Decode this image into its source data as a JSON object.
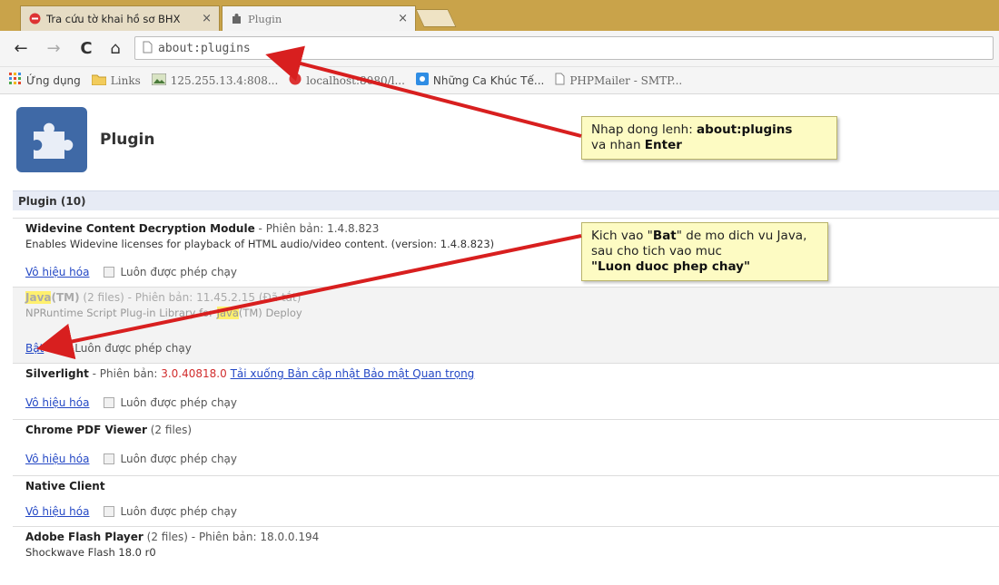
{
  "tabs": [
    {
      "title": "Tra cứu tờ khai hồ sơ BHX",
      "close": "×",
      "active": false
    },
    {
      "title": "Plugin",
      "close": "×",
      "active": true
    }
  ],
  "toolbar": {
    "back": "←",
    "forward": "→",
    "reload": "C",
    "home": "⌂",
    "url": "about:plugins"
  },
  "bookmarks": [
    {
      "label": "Ứng dụng",
      "icon": "apps-grid-icon"
    },
    {
      "label": "Links",
      "icon": "folder-icon"
    },
    {
      "label": "125.255.13.4:808...",
      "icon": "image-icon"
    },
    {
      "label": "localhost:8080/l...",
      "icon": "red-circle-icon"
    },
    {
      "label": "Những Ca Khúc Tế...",
      "icon": "blue-square-icon"
    },
    {
      "label": "PHPMailer - SMTP...",
      "icon": "document-icon"
    }
  ],
  "page": {
    "title": "Plugin",
    "section_label": "Plugin (10)"
  },
  "plugins": [
    {
      "name": "Widevine Content Decryption Module",
      "meta": " - Phiên bản: 1.4.8.823",
      "desc": "Enables Widevine licenses for playback of HTML audio/video content. (version: 1.4.8.823)",
      "action": "Vô hiệu hóa",
      "allow": "Luôn được phép chạy"
    },
    {
      "name": "Java",
      "name_suffix": "(TM)",
      "meta": " (2 files) - Phiên bản: 11.45.2.15 (Đã tắt)",
      "desc_pre": "NPRuntime Script Plug-in Library for ",
      "desc_hl": "Java",
      "desc_post": "(TM) Deploy",
      "action": "Bật",
      "allow": "Luôn được phép chạy"
    },
    {
      "name": "Silverlight",
      "meta": " - Phiên bản: ",
      "version": "3.0.40818.0",
      "update_link": "Tải xuống Bản cập nhật Bảo mật Quan trọng",
      "action": "Vô hiệu hóa",
      "allow": "Luôn được phép chạy"
    },
    {
      "name": "Chrome PDF Viewer",
      "meta": " (2 files)",
      "action": "Vô hiệu hóa",
      "allow": "Luôn được phép chạy"
    },
    {
      "name": "Native Client",
      "meta": "",
      "action": "Vô hiệu hóa",
      "allow": "Luôn được phép chạy"
    },
    {
      "name": "Adobe Flash Player",
      "meta": " (2 files) - Phiên bản: 18.0.0.194",
      "desc": "Shockwave Flash 18.0 r0"
    }
  ],
  "callouts": {
    "one_pre": "Nhap dong lenh: ",
    "one_bold": "about:plugins",
    "one_mid": "va nhan ",
    "one_bold2": "Enter",
    "two_pre": "Kich vao \"",
    "two_bold": "Bat",
    "two_mid": "\" de mo dich vu Java, sau cho tich vao muc",
    "two_bold2": "\"Luon duoc phep chay\""
  },
  "colors": {
    "arrow": "#d81f1f",
    "tabstrip": "#c9a34a",
    "link": "#2448c5",
    "puzzle": "#3f69a6"
  }
}
